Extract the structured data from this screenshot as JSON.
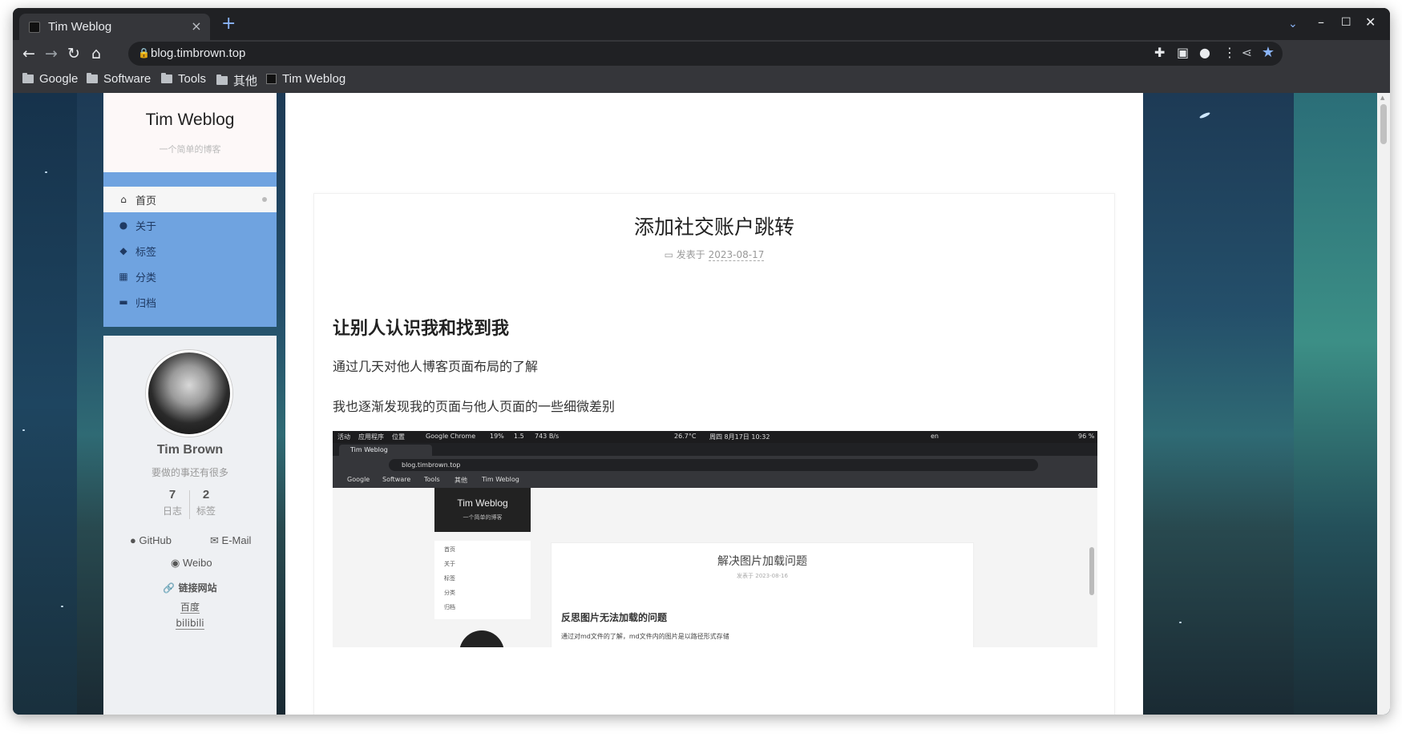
{
  "browser": {
    "tab_title": "Tim Weblog",
    "tab_close": "×",
    "new_tab": "+",
    "url": "blog.timbrown.top",
    "bookmarks": [
      "Google",
      "Software",
      "Tools",
      "其他",
      "Tim Weblog"
    ]
  },
  "blog": {
    "site_title": "Tim Weblog",
    "site_subtitle": "一个简单的博客",
    "menu": [
      {
        "label": "首页",
        "icon": "home-icon"
      },
      {
        "label": "关于",
        "icon": "user-icon"
      },
      {
        "label": "标签",
        "icon": "tags-icon"
      },
      {
        "label": "分类",
        "icon": "grid-icon"
      },
      {
        "label": "归档",
        "icon": "archive-icon"
      }
    ],
    "profile": {
      "name": "Tim Brown",
      "description": "要做的事还有很多",
      "posts_count": "7",
      "posts_label": "日志",
      "tags_count": "2",
      "tags_label": "标签",
      "github": "GitHub",
      "email": "E-Mail",
      "weibo": "Weibo",
      "links_title": "链接网站",
      "links": [
        "百度",
        "bilibili"
      ]
    },
    "post": {
      "title": "添加社交账户跳转",
      "meta_prefix": "发表于",
      "date": "2023-08-17",
      "heading": "让别人认识我和找到我",
      "paragraph1": "通过几天对他人博客页面布局的了解",
      "paragraph2": "我也逐渐发现我的页面与他人页面的一些细微差别"
    },
    "embedded_screenshot": {
      "top_bar": [
        "活动",
        "应用程序",
        "位置",
        "Google Chrome",
        "19%",
        "1.5",
        "743 B/s",
        "26.7°C",
        "周四 8月17日 10:32",
        "en",
        "96 %"
      ],
      "tab_title": "Tim Weblog",
      "url": "blog.timbrown.top",
      "bookmarks": [
        "Google",
        "Software",
        "Tools",
        "其他",
        "Tim Weblog"
      ],
      "site_title": "Tim Weblog",
      "site_subtitle": "一个简单的博客",
      "menu": [
        "首页",
        "关于",
        "标签",
        "分类",
        "归档"
      ],
      "post_title": "解决图片加载问题",
      "post_meta": "发表于 2023-08-16",
      "post_heading": "反思图片无法加载的问题",
      "post_text": "通过对md文件的了解，md文件内的图片是以路径形式存储"
    }
  }
}
